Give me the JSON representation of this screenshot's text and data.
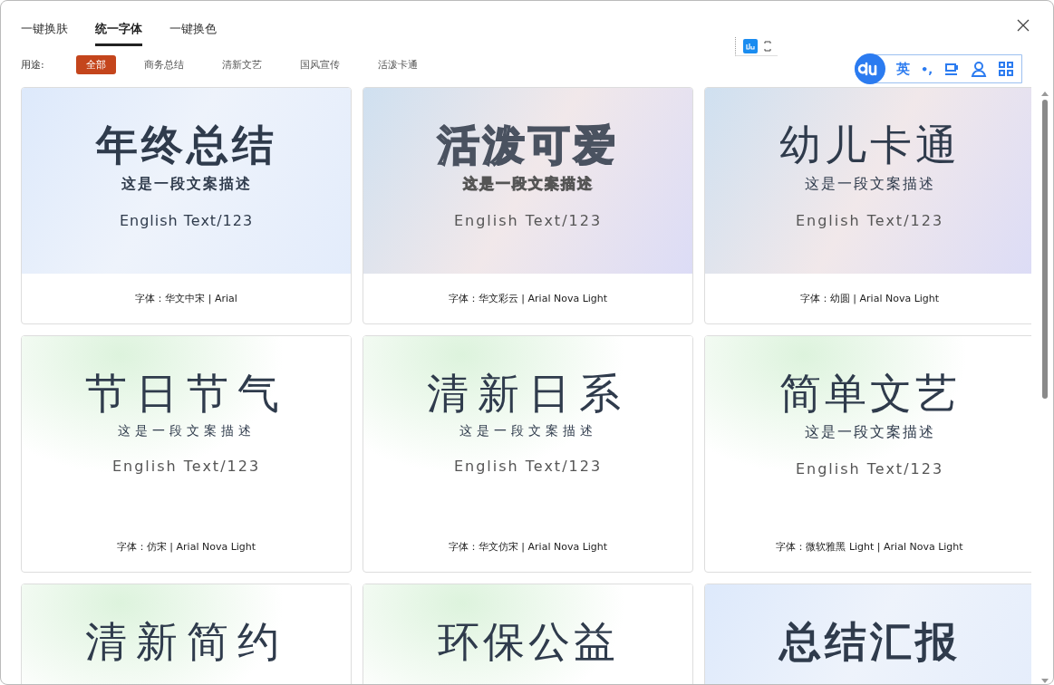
{
  "tabs": [
    {
      "label": "一键换肤",
      "selected": false
    },
    {
      "label": "统一字体",
      "selected": true
    },
    {
      "label": "一键换色",
      "selected": false
    }
  ],
  "filter": {
    "label": "用途:",
    "options": [
      {
        "label": "全部",
        "selected": true
      },
      {
        "label": "商务总结",
        "selected": false
      },
      {
        "label": "清新文艺",
        "selected": false
      },
      {
        "label": "国风宣传",
        "selected": false
      },
      {
        "label": "活泼卡通",
        "selected": false
      }
    ]
  },
  "ime": {
    "mode": "英",
    "punct": "•,"
  },
  "cards": [
    {
      "kind": "bold",
      "title": "年终总结",
      "subtitle": "这是一段文案描述",
      "english": "English  Text/123",
      "font_label": "字体：华文中宋 | Arial"
    },
    {
      "kind": "bubble",
      "title": "活泼可爱",
      "subtitle": "这是一段文案描述",
      "english": "English  Text/123",
      "font_label": "字体：华文彩云 | Arial Nova Light"
    },
    {
      "kind": "round",
      "title": "幼儿卡通",
      "subtitle": "这是一段文案描述",
      "english": "English  Text/123",
      "font_label": "字体：幼圆 | Arial Nova Light"
    },
    {
      "kind": "serif",
      "title": "节日节气",
      "subtitle": "这是一段文案描述",
      "english": "English  Text/123",
      "font_label": "字体：仿宋 | Arial Nova Light"
    },
    {
      "kind": "serif",
      "title": "清新日系",
      "subtitle": "这是一段文案描述",
      "english": "English  Text/123",
      "font_label": "字体：华文仿宋 | Arial Nova Light"
    },
    {
      "kind": "light",
      "title": "简单文艺",
      "subtitle": "这是一段文案描述",
      "english": "English  Text/123",
      "font_label": "字体：微软雅黑 Light | Arial Nova Light"
    },
    {
      "kind": "serif",
      "title": "清新简约"
    },
    {
      "kind": "light",
      "title": "环保公益"
    },
    {
      "kind": "bold",
      "title": "总结汇报"
    }
  ]
}
